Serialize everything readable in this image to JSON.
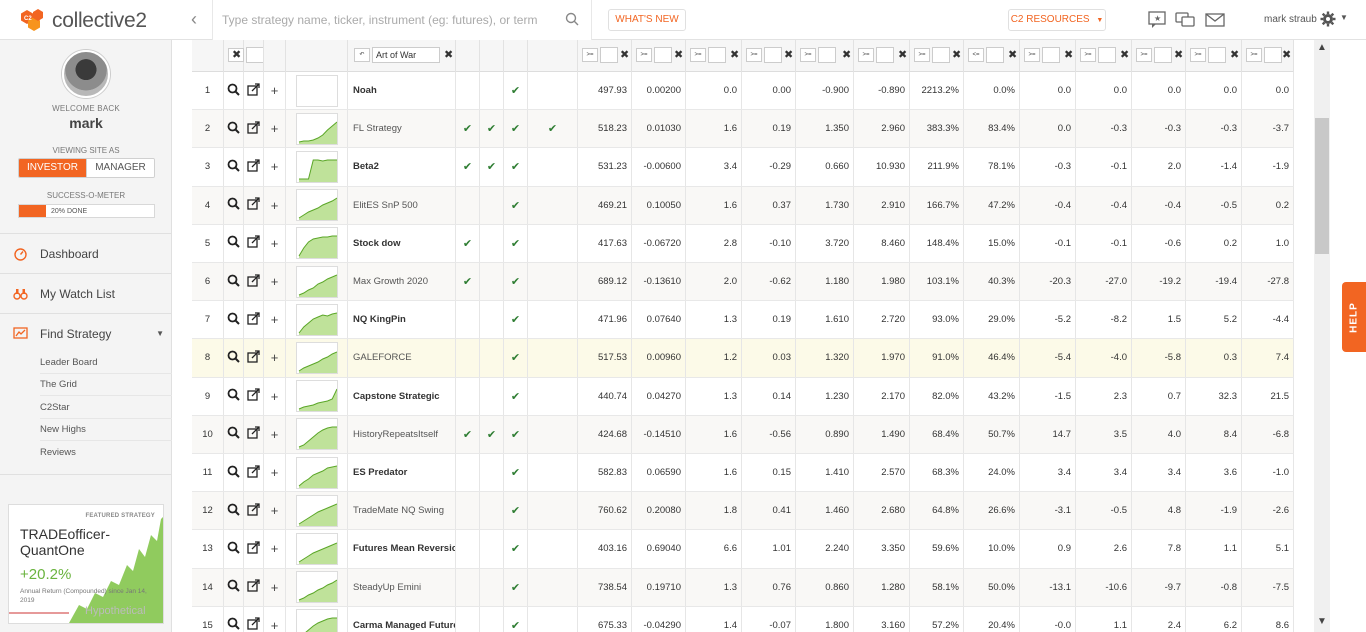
{
  "header": {
    "logo_text": "collective2",
    "search_placeholder": "Type strategy name, ticker, instrument (eg: futures), or term",
    "whats_new": "WHAT'S NEW",
    "resources": "C2 RESOURCES",
    "user_name": "mark straub"
  },
  "sidebar": {
    "welcome": "WELCOME BACK",
    "username": "mark",
    "viewing_as": "VIEWING SITE AS",
    "role_investor": "INVESTOR",
    "role_manager": "MANAGER",
    "success_label": "SUCCESS-O-METER",
    "success_text": "20% DONE",
    "success_pct": 20,
    "nav": [
      {
        "label": "Dashboard"
      },
      {
        "label": "My Watch List"
      },
      {
        "label": "Find Strategy"
      }
    ],
    "sub_items": [
      "Leader Board",
      "The Grid",
      "C2Star",
      "New Highs",
      "Reviews"
    ],
    "featured": {
      "tag": "FEATURED STRATEGY",
      "name": "TRADEofficer-QuantOne",
      "pct": "+20.2%",
      "desc": "Annual Return (Compounded) since Jan 14, 2019",
      "hypothetical": "Hypothetical"
    }
  },
  "grid": {
    "name_filter": "Art of War",
    "rows": [
      {
        "rank": "1",
        "name": "Noah",
        "bold": true,
        "checks": [
          false,
          false,
          true,
          false
        ],
        "v1": "497.93",
        "v2": "0.00200",
        "v3": "0.0",
        "v4": "0.00",
        "v5": "-0.900",
        "v6": "-0.890",
        "v7": "2213.2%",
        "v8": "0.0%",
        "v9": "0.0",
        "v10": "0.0",
        "v11": "0.0",
        "v12": "0.0",
        "v13": "0.0",
        "spark": []
      },
      {
        "rank": "2",
        "name": "FL Strategy",
        "bold": false,
        "checks": [
          true,
          true,
          true,
          true
        ],
        "v1": "518.23",
        "v2": "0.01030",
        "v3": "1.6",
        "v4": "0.19",
        "v5": "1.350",
        "v6": "2.960",
        "v7": "383.3%",
        "v8": "83.4%",
        "v9": "0.0",
        "v10": "-0.3",
        "v11": "-0.3",
        "v12": "-0.3",
        "v13": "-3.7",
        "spark": [
          2,
          3,
          3,
          4,
          6,
          9,
          14,
          18,
          22
        ]
      },
      {
        "rank": "3",
        "name": "Beta2",
        "bold": true,
        "checks": [
          true,
          true,
          true,
          false
        ],
        "v1": "531.23",
        "v2": "-0.00600",
        "v3": "3.4",
        "v4": "-0.29",
        "v5": "0.660",
        "v6": "10.930",
        "v7": "211.9%",
        "v8": "78.1%",
        "v9": "-0.3",
        "v10": "-0.1",
        "v11": "2.0",
        "v12": "-1.4",
        "v13": "-1.9",
        "spark": [
          3,
          3,
          3,
          22,
          22,
          21,
          22,
          22,
          22
        ]
      },
      {
        "rank": "4",
        "name": "ElitES SnP 500",
        "bold": false,
        "checks": [
          false,
          false,
          true,
          false
        ],
        "v1": "469.21",
        "v2": "0.10050",
        "v3": "1.6",
        "v4": "0.37",
        "v5": "1.730",
        "v6": "2.910",
        "v7": "166.7%",
        "v8": "47.2%",
        "v9": "-0.4",
        "v10": "-0.4",
        "v11": "-0.4",
        "v12": "-0.5",
        "v13": "0.2",
        "spark": [
          2,
          5,
          8,
          10,
          12,
          15,
          17,
          19,
          22
        ]
      },
      {
        "rank": "5",
        "name": "Stock dow",
        "bold": true,
        "checks": [
          true,
          false,
          true,
          false
        ],
        "v1": "417.63",
        "v2": "-0.06720",
        "v3": "2.8",
        "v4": "-0.10",
        "v5": "3.720",
        "v6": "8.460",
        "v7": "148.4%",
        "v8": "15.0%",
        "v9": "-0.1",
        "v10": "-0.1",
        "v11": "-0.6",
        "v12": "0.2",
        "v13": "1.0",
        "spark": [
          2,
          10,
          16,
          19,
          20,
          21,
          21,
          22,
          22
        ]
      },
      {
        "rank": "6",
        "name": "Max Growth 2020",
        "bold": false,
        "checks": [
          true,
          false,
          true,
          false
        ],
        "v1": "689.12",
        "v2": "-0.13610",
        "v3": "2.0",
        "v4": "-0.62",
        "v5": "1.180",
        "v6": "1.980",
        "v7": "103.1%",
        "v8": "40.3%",
        "v9": "-20.3",
        "v10": "-27.0",
        "v11": "-19.2",
        "v12": "-19.4",
        "v13": "-27.8",
        "spark": [
          2,
          4,
          7,
          9,
          13,
          15,
          18,
          20,
          22
        ]
      },
      {
        "rank": "7",
        "name": "NQ KingPin",
        "bold": true,
        "checks": [
          false,
          false,
          true,
          false
        ],
        "v1": "471.96",
        "v2": "0.07640",
        "v3": "1.3",
        "v4": "0.19",
        "v5": "1.610",
        "v6": "2.720",
        "v7": "93.0%",
        "v8": "29.0%",
        "v9": "-5.2",
        "v10": "-8.2",
        "v11": "1.5",
        "v12": "5.2",
        "v13": "-4.4",
        "spark": [
          2,
          8,
          12,
          16,
          18,
          20,
          19,
          21,
          22
        ]
      },
      {
        "rank": "8",
        "name": "GALEFORCE",
        "bold": false,
        "checks": [
          false,
          false,
          true,
          false
        ],
        "v1": "517.53",
        "v2": "0.00960",
        "v3": "1.2",
        "v4": "0.03",
        "v5": "1.320",
        "v6": "1.970",
        "v7": "91.0%",
        "v8": "46.4%",
        "v9": "-5.4",
        "v10": "-4.0",
        "v11": "-5.8",
        "v12": "0.3",
        "v13": "7.4",
        "spark": [
          2,
          5,
          7,
          9,
          11,
          14,
          16,
          19,
          21
        ]
      },
      {
        "rank": "9",
        "name": "Capstone Strategic",
        "bold": true,
        "checks": [
          false,
          false,
          true,
          false
        ],
        "v1": "440.74",
        "v2": "0.04270",
        "v3": "1.3",
        "v4": "0.14",
        "v5": "1.230",
        "v6": "2.170",
        "v7": "82.0%",
        "v8": "43.2%",
        "v9": "-1.5",
        "v10": "2.3",
        "v11": "0.7",
        "v12": "32.3",
        "v13": "21.5",
        "spark": [
          2,
          4,
          5,
          6,
          8,
          9,
          10,
          12,
          22
        ]
      },
      {
        "rank": "10",
        "name": "HistoryRepeatsItself",
        "bold": false,
        "checks": [
          true,
          true,
          true,
          false
        ],
        "v1": "424.68",
        "v2": "-0.14510",
        "v3": "1.6",
        "v4": "-0.56",
        "v5": "0.890",
        "v6": "1.490",
        "v7": "68.4%",
        "v8": "50.7%",
        "v9": "14.7",
        "v10": "3.5",
        "v11": "4.0",
        "v12": "8.4",
        "v13": "-6.8",
        "spark": [
          2,
          4,
          8,
          12,
          16,
          19,
          21,
          22,
          22
        ]
      },
      {
        "rank": "11",
        "name": "ES Predator",
        "bold": true,
        "checks": [
          false,
          false,
          true,
          false
        ],
        "v1": "582.83",
        "v2": "0.06590",
        "v3": "1.6",
        "v4": "0.15",
        "v5": "1.410",
        "v6": "2.570",
        "v7": "68.3%",
        "v8": "24.0%",
        "v9": "3.4",
        "v10": "3.4",
        "v11": "3.4",
        "v12": "3.6",
        "v13": "-1.0",
        "spark": [
          2,
          6,
          9,
          13,
          15,
          17,
          20,
          21,
          22
        ]
      },
      {
        "rank": "12",
        "name": "TradeMate NQ Swing",
        "bold": false,
        "checks": [
          false,
          false,
          true,
          false
        ],
        "v1": "760.62",
        "v2": "0.20080",
        "v3": "1.8",
        "v4": "0.41",
        "v5": "1.460",
        "v6": "2.680",
        "v7": "64.8%",
        "v8": "26.6%",
        "v9": "-3.1",
        "v10": "-0.5",
        "v11": "4.8",
        "v12": "-1.9",
        "v13": "-2.6",
        "spark": [
          2,
          5,
          8,
          11,
          14,
          16,
          18,
          20,
          22
        ]
      },
      {
        "rank": "13",
        "name": "Futures Mean Reversion",
        "bold": true,
        "checks": [
          false,
          false,
          true,
          false
        ],
        "v1": "403.16",
        "v2": "0.69040",
        "v3": "6.6",
        "v4": "1.01",
        "v5": "2.240",
        "v6": "3.350",
        "v7": "59.6%",
        "v8": "10.0%",
        "v9": "0.9",
        "v10": "2.6",
        "v11": "7.8",
        "v12": "1.1",
        "v13": "5.1",
        "spark": [
          2,
          5,
          8,
          11,
          13,
          15,
          17,
          19,
          21
        ]
      },
      {
        "rank": "14",
        "name": "SteadyUp Emini",
        "bold": false,
        "checks": [
          false,
          false,
          true,
          false
        ],
        "v1": "738.54",
        "v2": "0.19710",
        "v3": "1.3",
        "v4": "0.76",
        "v5": "0.860",
        "v6": "1.280",
        "v7": "58.1%",
        "v8": "50.0%",
        "v9": "-13.1",
        "v10": "-10.6",
        "v11": "-9.7",
        "v12": "-0.8",
        "v13": "-7.5",
        "spark": [
          2,
          4,
          7,
          9,
          12,
          14,
          17,
          19,
          22
        ]
      },
      {
        "rank": "15",
        "name": "Carma Managed Futures",
        "bold": true,
        "checks": [
          false,
          false,
          true,
          false
        ],
        "v1": "675.33",
        "v2": "-0.04290",
        "v3": "1.4",
        "v4": "-0.07",
        "v5": "1.800",
        "v6": "3.160",
        "v7": "57.2%",
        "v8": "20.4%",
        "v9": "-0.0",
        "v10": "1.1",
        "v11": "2.4",
        "v12": "6.2",
        "v13": "8.6",
        "spark": [
          2,
          6,
          10,
          14,
          17,
          19,
          21,
          22,
          22
        ]
      }
    ],
    "filter_ops": [
      ">=",
      ">=",
      ">=",
      ">=",
      ">=",
      ">=",
      ">=",
      "<=",
      ">=",
      ">=",
      ">=",
      ">=",
      ">="
    ]
  },
  "help_label": "HELP"
}
